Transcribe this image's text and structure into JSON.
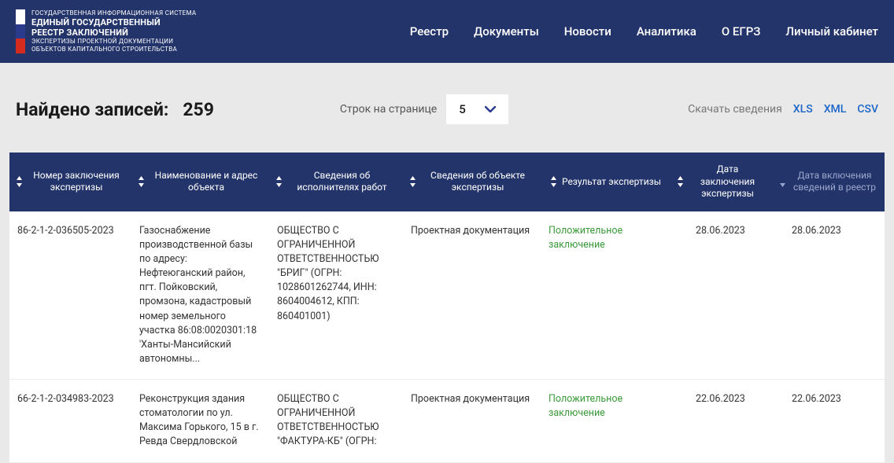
{
  "header": {
    "logo": {
      "line1": "ГОСУДАРСТВЕННАЯ ИНФОРМАЦИОННАЯ СИСТЕМА",
      "line2": "ЕДИНЫЙ ГОСУДАРСТВЕННЫЙ",
      "line3": "РЕЕСТР ЗАКЛЮЧЕНИЙ",
      "line4": "ЭКСПЕРТИЗЫ ПРОЕКТНОЙ ДОКУМЕНТАЦИИ",
      "line5": "ОБЪЕКТОВ КАПИТАЛЬНОГО СТРОИТЕЛЬСТВА"
    },
    "nav": {
      "registry": "Реестр",
      "documents": "Документы",
      "news": "Новости",
      "analytics": "Аналитика",
      "about": "О ЕГРЗ",
      "account": "Личный кабинет"
    }
  },
  "controls": {
    "found_label": "Найдено записей:",
    "found_count": "259",
    "rows_label": "Строк на странице",
    "rows_value": "5",
    "download_label": "Скачать сведения",
    "download_xls": "XLS",
    "download_xml": "XML",
    "download_csv": "CSV"
  },
  "table": {
    "headers": {
      "number": "Номер заключения экспертизы",
      "name": "Наименование и адрес объекта",
      "executor": "Сведения об исполнителях работ",
      "object": "Сведения об объекте экспертизы",
      "result": "Результат экспертизы",
      "date_conclusion": "Дата заключения экспертизы",
      "date_inclusion": "Дата включения сведений в реестр"
    },
    "rows": [
      {
        "number": "86-2-1-2-036505-2023",
        "name": "Газоснабжение производственной базы по адресу: Нефтеюганский район, пгт. Пойковский, промзона, кадастровый номер земельного участка 86:08:0020301:18 'Ханты-Мансийский автономны...",
        "executor": "ОБЩЕСТВО С ОГРАНИЧЕННОЙ ОТВЕТСТВЕННОСТЬЮ \"БРИГ\" (ОГРН: 1028601262744, ИНН: 8604004612, КПП: 860401001)",
        "object": "Проектная документация",
        "result": "Положительное заключение",
        "date_conclusion": "28.06.2023",
        "date_inclusion": "28.06.2023"
      },
      {
        "number": "66-2-1-2-034983-2023",
        "name": "Реконструкция здания стоматологии по ул. Максима Горького, 15 в г. Ревда Свердловской",
        "executor": "ОБЩЕСТВО С ОГРАНИЧЕННОЙ ОТВЕТСТВЕННОСТЬЮ \"ФАКТУРА-КБ\" (ОГРН:",
        "object": "Проектная документация",
        "result": "Положительное заключение",
        "date_conclusion": "22.06.2023",
        "date_inclusion": "22.06.2023"
      }
    ]
  }
}
